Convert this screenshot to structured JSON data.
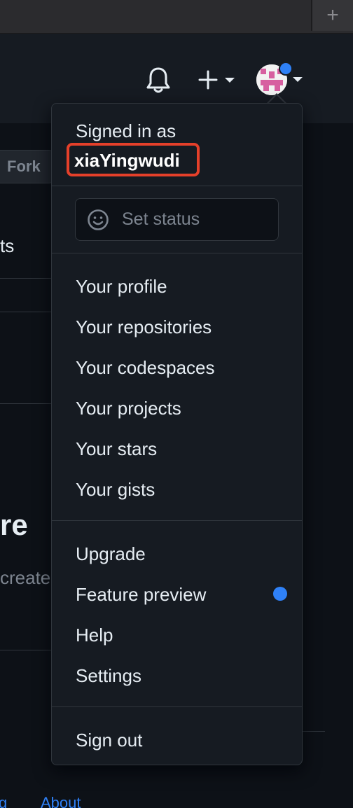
{
  "browser": {
    "new_tab_glyph": "+"
  },
  "header": {
    "notifications_icon": "bell-icon",
    "create_menu_icon": "plus-icon",
    "avatar_icon": "identicon-avatar",
    "has_unread_dot": true
  },
  "background": {
    "fork_label": "Fork",
    "fragment_ts": "ts",
    "fragment_re": "re",
    "fragment_create": "create",
    "fragment_footer_left": "g",
    "fragment_footer_about": "About"
  },
  "menu": {
    "signed_in_label": "Signed in as",
    "username": "xiaYingwudi",
    "set_status": {
      "icon": "smiley-icon",
      "label": "Set status"
    },
    "profile_items": [
      "Your profile",
      "Your repositories",
      "Your codespaces",
      "Your projects",
      "Your stars",
      "Your gists"
    ],
    "account_items": [
      "Upgrade",
      "Feature preview",
      "Help",
      "Settings"
    ],
    "sign_out": "Sign out"
  },
  "colors": {
    "accent_blue": "#2f81f7",
    "highlight_red": "#e5402a",
    "menu_bg": "#161b22",
    "page_bg": "#0d1117"
  }
}
